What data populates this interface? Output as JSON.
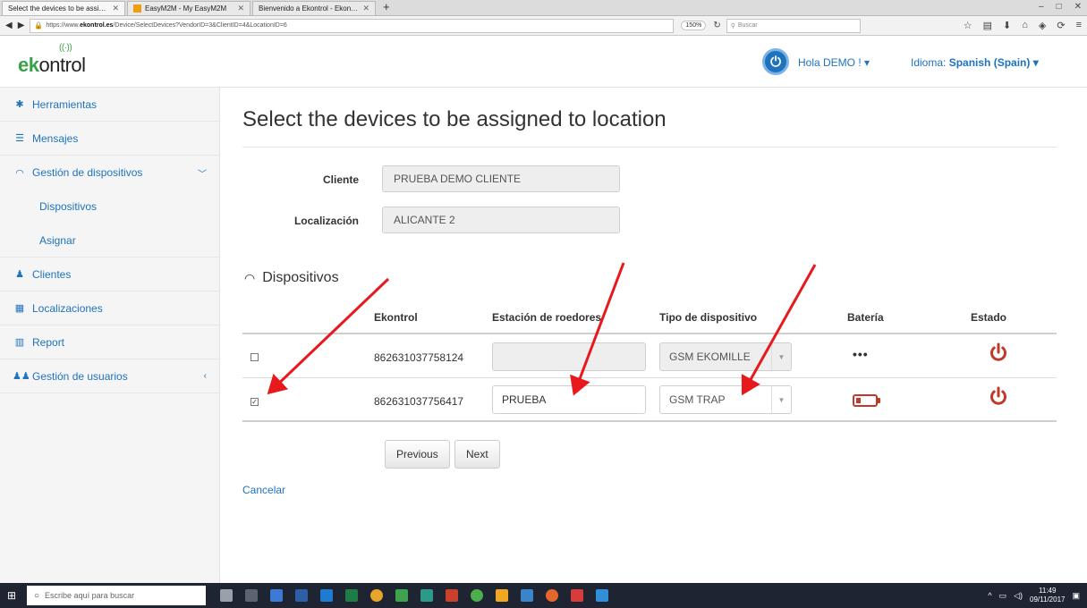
{
  "browser": {
    "tabs": [
      {
        "label": "Select the devices to be assigne",
        "active": true
      },
      {
        "label": "EasyM2M - My EasyM2M",
        "active": false
      },
      {
        "label": "Bienvenido a Ekontrol - Ekontrol",
        "active": false
      }
    ],
    "new_tab": "+",
    "url_prefix": "https://www.",
    "url_host": "ekontrol.es",
    "url_path": "/Device/SelectDevices?VendorID=3&ClientID=4&LocationID=6",
    "zoom": "150%",
    "search_placeholder": "Buscar"
  },
  "header": {
    "logo_bold": "ek",
    "logo_rest": "ontrol",
    "greeting": "Hola DEMO ! ▾",
    "language_label": "Idioma: ",
    "language_value": "Spanish (Spain) ▾"
  },
  "sidebar": {
    "items": [
      {
        "label": "Herramientas",
        "icon": "dashboard-icon"
      },
      {
        "label": "Mensajes",
        "icon": "list-icon"
      },
      {
        "label": "Gestión de dispositivos",
        "icon": "wifi-icon"
      },
      {
        "label": "Dispositivos"
      },
      {
        "label": "Asignar"
      },
      {
        "label": "Clientes",
        "icon": "user-icon"
      },
      {
        "label": "Localizaciones",
        "icon": "building-icon"
      },
      {
        "label": "Report",
        "icon": "bar-chart-icon"
      },
      {
        "label": "Gestión de usuarios",
        "icon": "users-icon"
      }
    ]
  },
  "main": {
    "title": "Select the devices to be assigned to location",
    "cliente_label": "Cliente",
    "cliente_value": "PRUEBA DEMO CLIENTE",
    "localizacion_label": "Localización",
    "localizacion_value": "ALICANTE 2",
    "section_title": "Dispositivos",
    "columns": [
      "Ekontrol",
      "Estación de roedores",
      "Tipo de dispositivo",
      "Batería",
      "Estado"
    ],
    "rows": [
      {
        "checked": false,
        "ekontrol": "862631037758124",
        "estacion": "",
        "tipo": "GSM EKOMILLE",
        "bateria": "•••",
        "estado_color": "#c0392b"
      },
      {
        "checked": true,
        "ekontrol": "862631037756417",
        "estacion": "PRUEBA",
        "tipo": "GSM TRAP",
        "bateria_level": 0.25,
        "estado_color": "#c0392b"
      }
    ],
    "previous_label": "Previous",
    "next_label": "Next",
    "cancel_label": "Cancelar"
  },
  "taskbar": {
    "search_placeholder": "Escribe aquí para buscar",
    "time": "11:49",
    "date": "09/11/2017"
  },
  "colors": {
    "accent": "#1e73be",
    "danger": "#c0392b",
    "annotation_arrow": "#e8191c",
    "brand_green": "#3aa14a"
  }
}
